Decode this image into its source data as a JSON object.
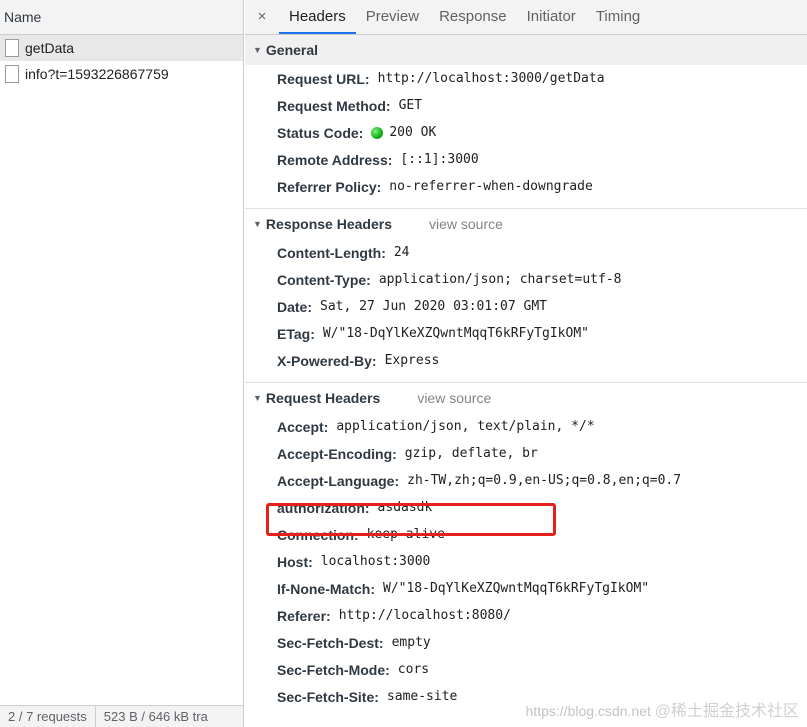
{
  "left": {
    "header": "Name",
    "requests": [
      {
        "name": "getData",
        "selected": true
      },
      {
        "name": "info?t=1593226867759",
        "selected": false
      }
    ],
    "status": {
      "requests": "2 / 7 requests",
      "transferred": "523 B / 646 kB tra"
    }
  },
  "tabs": {
    "close": "×",
    "items": [
      "Headers",
      "Preview",
      "Response",
      "Initiator",
      "Timing"
    ],
    "active": "Headers"
  },
  "general": {
    "title": "General",
    "rows": [
      {
        "key": "Request URL:",
        "value": "http://localhost:3000/getData"
      },
      {
        "key": "Request Method:",
        "value": "GET"
      },
      {
        "key": "Status Code:",
        "value": "200 OK"
      },
      {
        "key": "Remote Address:",
        "value": "[::1]:3000"
      },
      {
        "key": "Referrer Policy:",
        "value": "no-referrer-when-downgrade"
      }
    ]
  },
  "response_headers": {
    "title": "Response Headers",
    "view_source": "view source",
    "rows": [
      {
        "key": "Content-Length:",
        "value": "24"
      },
      {
        "key": "Content-Type:",
        "value": "application/json; charset=utf-8"
      },
      {
        "key": "Date:",
        "value": "Sat, 27 Jun 2020 03:01:07 GMT"
      },
      {
        "key": "ETag:",
        "value": "W/\"18-DqYlKeXZQwntMqqT6kRFyTgIkOM\""
      },
      {
        "key": "X-Powered-By:",
        "value": "Express"
      }
    ]
  },
  "request_headers": {
    "title": "Request Headers",
    "view_source": "view source",
    "rows": [
      {
        "key": "Accept:",
        "value": "application/json, text/plain, */*"
      },
      {
        "key": "Accept-Encoding:",
        "value": "gzip, deflate, br"
      },
      {
        "key": "Accept-Language:",
        "value": "zh-TW,zh;q=0.9,en-US;q=0.8,en;q=0.7"
      },
      {
        "key": "authorization:",
        "value": "asdasdk"
      },
      {
        "key": "Connection:",
        "value": "keep-alive"
      },
      {
        "key": "Host:",
        "value": "localhost:3000"
      },
      {
        "key": "If-None-Match:",
        "value": "W/\"18-DqYlKeXZQwntMqqT6kRFyTgIkOM\""
      },
      {
        "key": "Referer:",
        "value": "http://localhost:8080/"
      },
      {
        "key": "Sec-Fetch-Dest:",
        "value": "empty"
      },
      {
        "key": "Sec-Fetch-Mode:",
        "value": "cors"
      },
      {
        "key": "Sec-Fetch-Site:",
        "value": "same-site"
      }
    ]
  },
  "watermark": {
    "url": "https://blog.csdn.net",
    "brand": "@稀土掘金技术社区"
  },
  "colors": {
    "active_tab": "#1a73e8",
    "highlight_box": "#e8201a",
    "status_dot": "#0fae1a"
  }
}
